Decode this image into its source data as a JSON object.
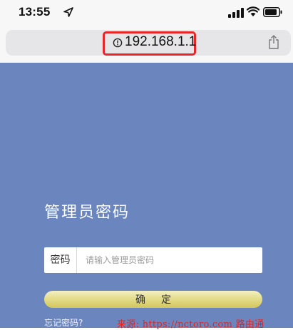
{
  "status_bar": {
    "time": "13:55",
    "icons": [
      "location-arrow-icon",
      "signal-icon",
      "wifi-icon",
      "battery-icon"
    ]
  },
  "browser": {
    "url": "192.168.1.1",
    "url_icon": "info-circle-icon",
    "share_icon": "share-icon",
    "highlight_color": "#e5262a"
  },
  "login": {
    "title": "管理员密码",
    "password_label": "密码",
    "password_placeholder": "请输入管理员密码",
    "password_value": "",
    "confirm_label": "确定",
    "forgot_link": "忘记密码?",
    "panel_color": "#6b86be"
  },
  "watermark": {
    "text": "来源: https://nctoro.com 路由通"
  }
}
